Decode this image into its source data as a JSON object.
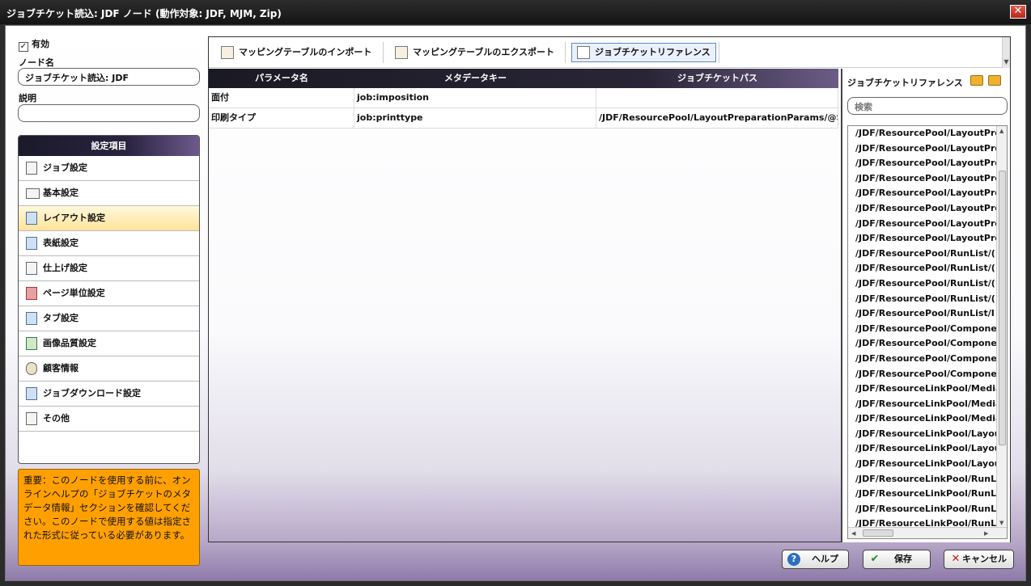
{
  "window": {
    "title": "ジョブチケット読込: JDF ノード (動作対象: JDF, MJM, Zip)",
    "close_glyph": "✕"
  },
  "left": {
    "enabled_label": "有効",
    "enabled_checked": true,
    "node_name_label": "ノード名",
    "node_name_value": "ジョブチケット読込: JDF",
    "description_label": "説明",
    "description_value": ""
  },
  "settings": {
    "header": "設定項目",
    "items": [
      {
        "label": "ジョブ設定",
        "icon": "document-icon"
      },
      {
        "label": "基本設定",
        "icon": "list-icon"
      },
      {
        "label": "レイアウト設定",
        "icon": "layout-icon"
      },
      {
        "label": "表紙設定",
        "icon": "cover-icon"
      },
      {
        "label": "仕上げ設定",
        "icon": "finishing-icon"
      },
      {
        "label": "ページ単位設定",
        "icon": "pages-icon"
      },
      {
        "label": "タブ設定",
        "icon": "tab-icon"
      },
      {
        "label": "画像品質設定",
        "icon": "image-icon"
      },
      {
        "label": "顧客情報",
        "icon": "customer-icon"
      },
      {
        "label": "ジョブダウンロード設定",
        "icon": "download-icon"
      },
      {
        "label": "その他",
        "icon": "other-icon"
      }
    ],
    "active_index": 2
  },
  "notice": "重要：このノードを使用する前に、オンラインヘルプの「ジョブチケットのメタデータ情報」セクションを確認してください。このノードで使用する値は指定された形式に従っている必要があります。",
  "toolbar": {
    "import_label": "マッピングテーブルのインポート",
    "export_label": "マッピングテーブルのエクスポート",
    "reference_label": "ジョブチケットリファレンス",
    "scroll_glyph": "▼"
  },
  "table": {
    "headers": [
      "パラメータ名",
      "メタデータキー",
      "ジョブチケットパス"
    ],
    "rows": [
      [
        "面付",
        "job:imposition",
        ""
      ],
      [
        "印刷タイプ",
        "job:printtype",
        "/JDF/ResourcePool/LayoutPreparationParams/@S"
      ]
    ]
  },
  "reference": {
    "title": "ジョブチケットリファレンス",
    "search_placeholder": "検索",
    "items": [
      "/JDF/ResourcePool/LayoutPre",
      "/JDF/ResourcePool/LayoutPre",
      "/JDF/ResourcePool/LayoutPre",
      "/JDF/ResourcePool/LayoutPre",
      "/JDF/ResourcePool/LayoutPre",
      "/JDF/ResourcePool/LayoutPre",
      "/JDF/ResourcePool/LayoutPre",
      "/JDF/ResourcePool/LayoutPre",
      "/JDF/ResourcePool/RunList/(",
      "/JDF/ResourcePool/RunList/(",
      "/JDF/ResourcePool/RunList/(",
      "/JDF/ResourcePool/RunList/(",
      "/JDF/ResourcePool/RunList/I",
      "/JDF/ResourcePool/Compone",
      "/JDF/ResourcePool/Compone",
      "/JDF/ResourcePool/Compone",
      "/JDF/ResourcePool/Compone",
      "/JDF/ResourceLinkPool/Media",
      "/JDF/ResourceLinkPool/Media",
      "/JDF/ResourceLinkPool/Media",
      "/JDF/ResourceLinkPool/Layou",
      "/JDF/ResourceLinkPool/Layou",
      "/JDF/ResourceLinkPool/Layou",
      "/JDF/ResourceLinkPool/RunLi",
      "/JDF/ResourceLinkPool/RunLi",
      "/JDF/ResourceLinkPool/RunLi",
      "/JDF/ResourceLinkPool/RunLi"
    ]
  },
  "footer": {
    "help_label": "ヘルプ",
    "save_label": "保存",
    "cancel_label": "キャンセル",
    "help_glyph": "?",
    "save_glyph": "✔",
    "cancel_glyph": "✕"
  },
  "colors": {
    "accent_purple": "#6b5c86",
    "notice_orange": "#ffa000",
    "active_item": "#ffe39a"
  }
}
